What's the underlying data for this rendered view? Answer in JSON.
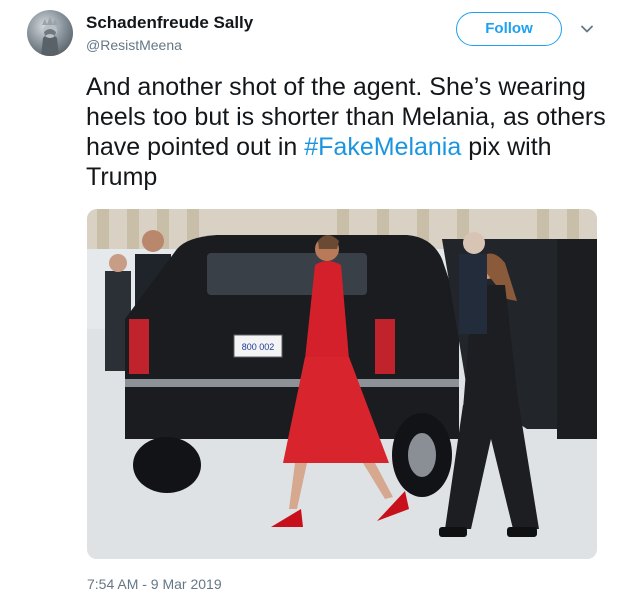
{
  "user": {
    "display_name": "Schadenfreude Sally",
    "handle": "@ResistMeena",
    "avatar_icon": "statue-of-liberty-facepalm-avatar"
  },
  "follow_button": {
    "label": "Follow"
  },
  "more_menu": {
    "icon": "chevron-down-icon"
  },
  "tweet": {
    "text_before": "And another shot of the agent. She’s wearing heels too but is shorter than Melania, as others have pointed out in ",
    "hashtag": "#FakeMelania",
    "text_after": " pix with Trump"
  },
  "photo": {
    "license_plate": "800 002"
  },
  "timestamp": "7:54 AM - 9 Mar 2019",
  "colors": {
    "accent": "#1da1f2",
    "hashtag": "#1b95e0",
    "secondary_text": "#657786"
  }
}
